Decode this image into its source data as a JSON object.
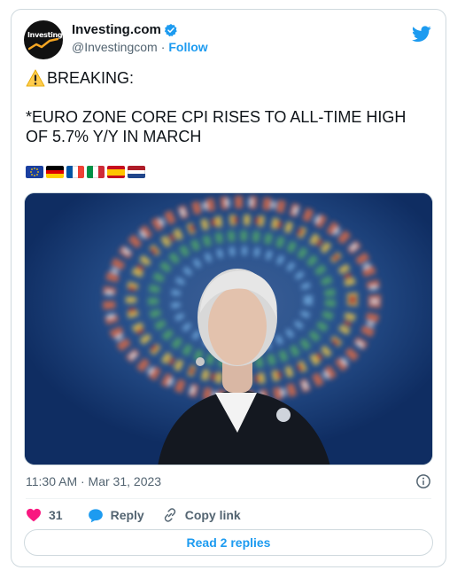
{
  "author": {
    "display_name": "Investing.com",
    "handle": "@Investingcom",
    "separator": "·",
    "follow_label": "Follow",
    "avatar_text": "Investing.com",
    "verified": true
  },
  "tweet": {
    "line1": "BREAKING:",
    "line2": "*EURO ZONE CORE CPI RISES TO ALL-TIME HIGH OF 5.7% Y/Y IN MARCH",
    "flags": [
      "eu-flag",
      "germany-flag",
      "france-flag",
      "italy-flag",
      "spain-flag",
      "netherlands-flag"
    ],
    "timestamp": "11:30 AM · Mar 31, 2023"
  },
  "actions": {
    "like_count": "31",
    "reply_label": "Reply",
    "copy_link_label": "Copy link"
  },
  "read_replies_label": "Read 2 replies",
  "colors": {
    "accent": "#1d9bf0",
    "like": "#f91880",
    "text": "#0f1419",
    "muted": "#536471",
    "border": "#cfd9de"
  }
}
